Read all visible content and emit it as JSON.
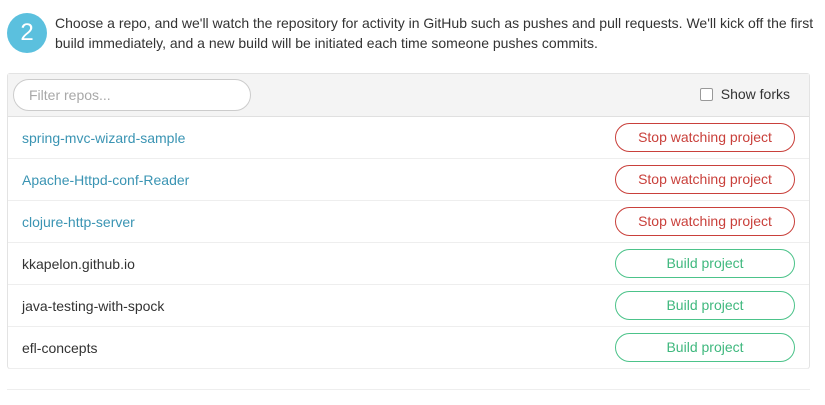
{
  "step": {
    "number": "2",
    "text": "Choose a repo, and we'll watch the repository for activity in GitHub such as pushes and pull requests. We'll kick off the first build immediately, and a new build will be initiated each time someone pushes commits."
  },
  "toolbar": {
    "filter_placeholder": "Filter repos...",
    "filter_value": "",
    "show_forks_label": "Show forks",
    "show_forks_checked": false
  },
  "repos": [
    {
      "name": "spring-mvc-wizard-sample",
      "watched": true,
      "action": "Stop watching project"
    },
    {
      "name": "Apache-Httpd-conf-Reader",
      "watched": true,
      "action": "Stop watching project"
    },
    {
      "name": "clojure-http-server",
      "watched": true,
      "action": "Stop watching project"
    },
    {
      "name": "kkapelon.github.io",
      "watched": false,
      "action": "Build project"
    },
    {
      "name": "java-testing-with-spock",
      "watched": false,
      "action": "Build project"
    },
    {
      "name": "efl-concepts",
      "watched": false,
      "action": "Build project"
    }
  ],
  "colors": {
    "badge": "#5bc0de",
    "watched_link": "#3a94b3",
    "stop_button": "#c9403b",
    "build_button": "#3fb87e"
  }
}
